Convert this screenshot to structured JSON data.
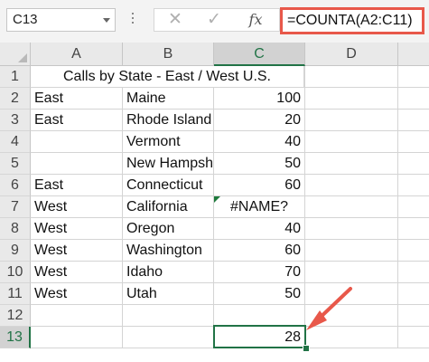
{
  "name_box": {
    "value": "C13"
  },
  "formula_bar": {
    "cancel_symbol": "✕",
    "enter_symbol": "✓",
    "fx_symbol": "fx",
    "formula": "=COUNTA(A2:C11)"
  },
  "columns": [
    "A",
    "B",
    "C",
    "D"
  ],
  "rows": [
    "1",
    "2",
    "3",
    "4",
    "5",
    "6",
    "7",
    "8",
    "9",
    "10",
    "11",
    "12",
    "13"
  ],
  "selected_cell": "C13",
  "sheet": {
    "title": "Calls by State - East / West U.S.",
    "data_rows": [
      {
        "region": "East",
        "state": "Maine",
        "calls": "100"
      },
      {
        "region": "East",
        "state": "Rhode Island",
        "calls": "20"
      },
      {
        "region": "",
        "state": "Vermont",
        "calls": "40"
      },
      {
        "region": "",
        "state": "New Hampshire",
        "calls": "50"
      },
      {
        "region": "East",
        "state": "Connecticut",
        "calls": "60"
      },
      {
        "region": "West",
        "state": "California",
        "calls": "#NAME?"
      },
      {
        "region": "West",
        "state": "Oregon",
        "calls": "40"
      },
      {
        "region": "West",
        "state": "Washington",
        "calls": "60"
      },
      {
        "region": "West",
        "state": "Idaho",
        "calls": "70"
      },
      {
        "region": "West",
        "state": "Utah",
        "calls": "50"
      }
    ],
    "result": "28"
  },
  "colors": {
    "selection": "#217346",
    "highlight": "#e8584a"
  }
}
